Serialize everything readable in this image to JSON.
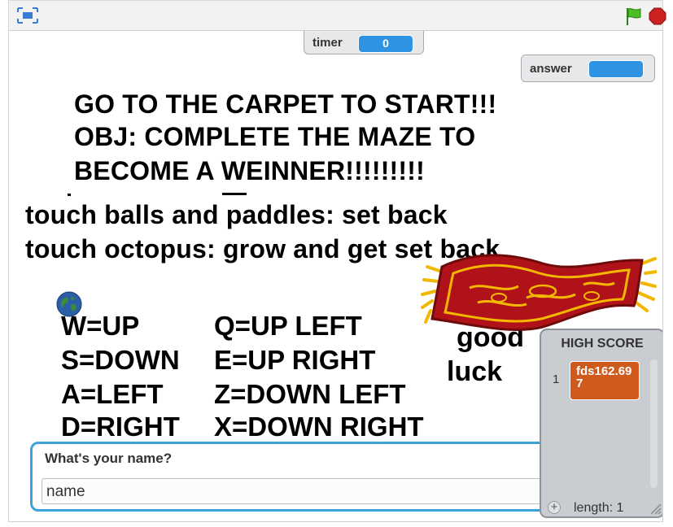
{
  "monitors": {
    "timer": {
      "label": "timer",
      "value": "0"
    },
    "answer": {
      "label": "answer",
      "value": ""
    }
  },
  "stage_text": {
    "line1": "GO TO THE CARPET TO START!!!",
    "line2": "OBJ: COMPLETE THE MAZE TO",
    "line3": "BECOME A WEINNER!!!!!!!!!",
    "touch1": "touch balls and paddles: set back",
    "touch2": "touch octopus: grow and get set back",
    "keys_left": [
      "W=UP",
      "S=DOWN",
      "A=LEFT",
      "D=RIGHT"
    ],
    "keys_right": [
      "Q=UP LEFT",
      "E=UP RIGHT",
      "Z=DOWN LEFT",
      "X=DOWN RIGHT"
    ],
    "good": "good",
    "luck": "luck"
  },
  "ask": {
    "question": "What's your name?",
    "input_value": "name"
  },
  "highscore": {
    "title": "HIGH SCORE",
    "index": "1",
    "item": "fds162.697",
    "length_label": "length: 1"
  },
  "icons": {
    "fullscreen": "fullscreen-toggle-icon",
    "flag": "green-flag-icon",
    "stop": "stop-sign-icon",
    "carpet": "carpet-sprite",
    "earth": "earth-sprite"
  },
  "colors": {
    "monitor_value": "#2f93e3",
    "list_item": "#cf5a1b",
    "ask_border": "#3ea2da",
    "flag_green": "#4cbf22",
    "stop_red": "#cc2222"
  }
}
